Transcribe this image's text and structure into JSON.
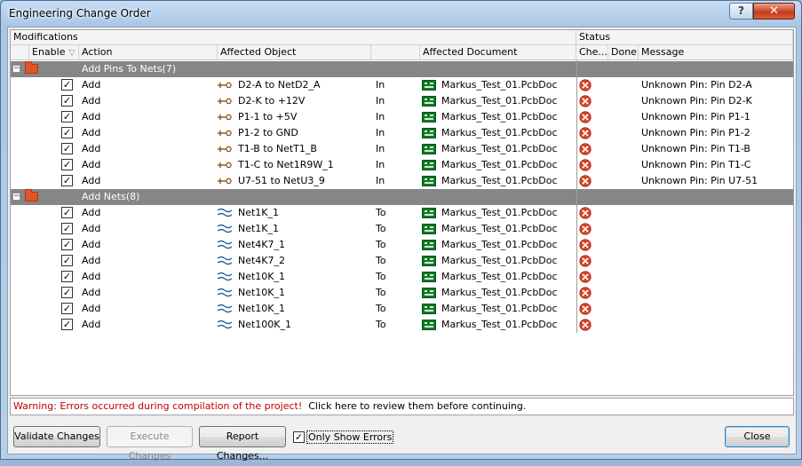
{
  "window": {
    "title": "Engineering Change Order",
    "help_glyph": "?",
    "close_glyph": "✕"
  },
  "groups": {
    "modifications": "Modifications",
    "status": "Status"
  },
  "columns": {
    "enable": "Enable",
    "action": "Action",
    "affected_object": "Affected Object",
    "affected_document": "Affected Document",
    "check": "Che...",
    "done": "Done",
    "message": "Message"
  },
  "sections": [
    {
      "title": "Add Pins To Nets(7)",
      "expander": "−",
      "rows": [
        {
          "enabled": true,
          "action": "Add",
          "object_icon": "pin-icon",
          "object": "D2-A to NetD2_A",
          "direction": "In",
          "document": "Markus_Test_01.PcbDoc",
          "check": "error-icon",
          "message": "Unknown Pin: Pin D2-A"
        },
        {
          "enabled": true,
          "action": "Add",
          "object_icon": "pin-icon",
          "object": "D2-K to +12V",
          "direction": "In",
          "document": "Markus_Test_01.PcbDoc",
          "check": "error-icon",
          "message": "Unknown Pin: Pin D2-K"
        },
        {
          "enabled": true,
          "action": "Add",
          "object_icon": "pin-icon",
          "object": "P1-1 to +5V",
          "direction": "In",
          "document": "Markus_Test_01.PcbDoc",
          "check": "error-icon",
          "message": "Unknown Pin: Pin P1-1"
        },
        {
          "enabled": true,
          "action": "Add",
          "object_icon": "pin-icon",
          "object": "P1-2 to GND",
          "direction": "In",
          "document": "Markus_Test_01.PcbDoc",
          "check": "error-icon",
          "message": "Unknown Pin: Pin P1-2"
        },
        {
          "enabled": true,
          "action": "Add",
          "object_icon": "pin-icon",
          "object": "T1-B to NetT1_B",
          "direction": "In",
          "document": "Markus_Test_01.PcbDoc",
          "check": "error-icon",
          "message": "Unknown Pin: Pin T1-B"
        },
        {
          "enabled": true,
          "action": "Add",
          "object_icon": "pin-icon",
          "object": "T1-C to Net1R9W_1",
          "direction": "In",
          "document": "Markus_Test_01.PcbDoc",
          "check": "error-icon",
          "message": "Unknown Pin: Pin T1-C"
        },
        {
          "enabled": true,
          "action": "Add",
          "object_icon": "pin-icon",
          "object": "U7-51 to NetU3_9",
          "direction": "In",
          "document": "Markus_Test_01.PcbDoc",
          "check": "error-icon",
          "message": "Unknown Pin: Pin U7-51"
        }
      ]
    },
    {
      "title": "Add Nets(8)",
      "expander": "−",
      "rows": [
        {
          "enabled": true,
          "action": "Add",
          "object_icon": "net-icon",
          "object": "Net1K_1",
          "direction": "To",
          "document": "Markus_Test_01.PcbDoc",
          "check": "error-icon",
          "message": ""
        },
        {
          "enabled": true,
          "action": "Add",
          "object_icon": "net-icon",
          "object": "Net1K_1",
          "direction": "To",
          "document": "Markus_Test_01.PcbDoc",
          "check": "error-icon",
          "message": ""
        },
        {
          "enabled": true,
          "action": "Add",
          "object_icon": "net-icon",
          "object": "Net4K7_1",
          "direction": "To",
          "document": "Markus_Test_01.PcbDoc",
          "check": "error-icon",
          "message": ""
        },
        {
          "enabled": true,
          "action": "Add",
          "object_icon": "net-icon",
          "object": "Net4K7_2",
          "direction": "To",
          "document": "Markus_Test_01.PcbDoc",
          "check": "error-icon",
          "message": ""
        },
        {
          "enabled": true,
          "action": "Add",
          "object_icon": "net-icon",
          "object": "Net10K_1",
          "direction": "To",
          "document": "Markus_Test_01.PcbDoc",
          "check": "error-icon",
          "message": ""
        },
        {
          "enabled": true,
          "action": "Add",
          "object_icon": "net-icon",
          "object": "Net10K_1",
          "direction": "To",
          "document": "Markus_Test_01.PcbDoc",
          "check": "error-icon",
          "message": ""
        },
        {
          "enabled": true,
          "action": "Add",
          "object_icon": "net-icon",
          "object": "Net10K_1",
          "direction": "To",
          "document": "Markus_Test_01.PcbDoc",
          "check": "error-icon",
          "message": ""
        },
        {
          "enabled": true,
          "action": "Add",
          "object_icon": "net-icon",
          "object": "Net100K_1",
          "direction": "To",
          "document": "Markus_Test_01.PcbDoc",
          "check": "error-icon",
          "message": ""
        }
      ]
    }
  ],
  "warning": {
    "error_text": "Warning: Errors occurred during compilation of the project!",
    "link_text": "Click here to review them before continuing."
  },
  "buttons": {
    "validate": "Validate Changes",
    "execute": "Execute Changes",
    "report": "Report Changes...",
    "close": "Close"
  },
  "only_show_errors": {
    "label": "Only Show Errors",
    "checked": true
  },
  "colors": {
    "group_row": "#868686",
    "warning_text": "#c00000",
    "error_icon": "#e0432a",
    "check_mark": "#000000"
  }
}
